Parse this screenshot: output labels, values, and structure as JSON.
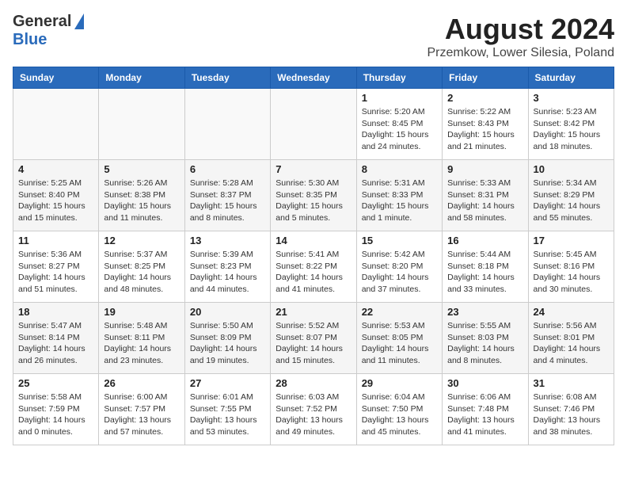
{
  "header": {
    "logo_general": "General",
    "logo_blue": "Blue",
    "month_year": "August 2024",
    "location": "Przemkow, Lower Silesia, Poland"
  },
  "weekdays": [
    "Sunday",
    "Monday",
    "Tuesday",
    "Wednesday",
    "Thursday",
    "Friday",
    "Saturday"
  ],
  "weeks": [
    [
      {
        "day": "",
        "sunrise": "",
        "sunset": "",
        "daylight": ""
      },
      {
        "day": "",
        "sunrise": "",
        "sunset": "",
        "daylight": ""
      },
      {
        "day": "",
        "sunrise": "",
        "sunset": "",
        "daylight": ""
      },
      {
        "day": "",
        "sunrise": "",
        "sunset": "",
        "daylight": ""
      },
      {
        "day": "1",
        "sunrise": "Sunrise: 5:20 AM",
        "sunset": "Sunset: 8:45 PM",
        "daylight": "Daylight: 15 hours and 24 minutes."
      },
      {
        "day": "2",
        "sunrise": "Sunrise: 5:22 AM",
        "sunset": "Sunset: 8:43 PM",
        "daylight": "Daylight: 15 hours and 21 minutes."
      },
      {
        "day": "3",
        "sunrise": "Sunrise: 5:23 AM",
        "sunset": "Sunset: 8:42 PM",
        "daylight": "Daylight: 15 hours and 18 minutes."
      }
    ],
    [
      {
        "day": "4",
        "sunrise": "Sunrise: 5:25 AM",
        "sunset": "Sunset: 8:40 PM",
        "daylight": "Daylight: 15 hours and 15 minutes."
      },
      {
        "day": "5",
        "sunrise": "Sunrise: 5:26 AM",
        "sunset": "Sunset: 8:38 PM",
        "daylight": "Daylight: 15 hours and 11 minutes."
      },
      {
        "day": "6",
        "sunrise": "Sunrise: 5:28 AM",
        "sunset": "Sunset: 8:37 PM",
        "daylight": "Daylight: 15 hours and 8 minutes."
      },
      {
        "day": "7",
        "sunrise": "Sunrise: 5:30 AM",
        "sunset": "Sunset: 8:35 PM",
        "daylight": "Daylight: 15 hours and 5 minutes."
      },
      {
        "day": "8",
        "sunrise": "Sunrise: 5:31 AM",
        "sunset": "Sunset: 8:33 PM",
        "daylight": "Daylight: 15 hours and 1 minute."
      },
      {
        "day": "9",
        "sunrise": "Sunrise: 5:33 AM",
        "sunset": "Sunset: 8:31 PM",
        "daylight": "Daylight: 14 hours and 58 minutes."
      },
      {
        "day": "10",
        "sunrise": "Sunrise: 5:34 AM",
        "sunset": "Sunset: 8:29 PM",
        "daylight": "Daylight: 14 hours and 55 minutes."
      }
    ],
    [
      {
        "day": "11",
        "sunrise": "Sunrise: 5:36 AM",
        "sunset": "Sunset: 8:27 PM",
        "daylight": "Daylight: 14 hours and 51 minutes."
      },
      {
        "day": "12",
        "sunrise": "Sunrise: 5:37 AM",
        "sunset": "Sunset: 8:25 PM",
        "daylight": "Daylight: 14 hours and 48 minutes."
      },
      {
        "day": "13",
        "sunrise": "Sunrise: 5:39 AM",
        "sunset": "Sunset: 8:23 PM",
        "daylight": "Daylight: 14 hours and 44 minutes."
      },
      {
        "day": "14",
        "sunrise": "Sunrise: 5:41 AM",
        "sunset": "Sunset: 8:22 PM",
        "daylight": "Daylight: 14 hours and 41 minutes."
      },
      {
        "day": "15",
        "sunrise": "Sunrise: 5:42 AM",
        "sunset": "Sunset: 8:20 PM",
        "daylight": "Daylight: 14 hours and 37 minutes."
      },
      {
        "day": "16",
        "sunrise": "Sunrise: 5:44 AM",
        "sunset": "Sunset: 8:18 PM",
        "daylight": "Daylight: 14 hours and 33 minutes."
      },
      {
        "day": "17",
        "sunrise": "Sunrise: 5:45 AM",
        "sunset": "Sunset: 8:16 PM",
        "daylight": "Daylight: 14 hours and 30 minutes."
      }
    ],
    [
      {
        "day": "18",
        "sunrise": "Sunrise: 5:47 AM",
        "sunset": "Sunset: 8:14 PM",
        "daylight": "Daylight: 14 hours and 26 minutes."
      },
      {
        "day": "19",
        "sunrise": "Sunrise: 5:48 AM",
        "sunset": "Sunset: 8:11 PM",
        "daylight": "Daylight: 14 hours and 23 minutes."
      },
      {
        "day": "20",
        "sunrise": "Sunrise: 5:50 AM",
        "sunset": "Sunset: 8:09 PM",
        "daylight": "Daylight: 14 hours and 19 minutes."
      },
      {
        "day": "21",
        "sunrise": "Sunrise: 5:52 AM",
        "sunset": "Sunset: 8:07 PM",
        "daylight": "Daylight: 14 hours and 15 minutes."
      },
      {
        "day": "22",
        "sunrise": "Sunrise: 5:53 AM",
        "sunset": "Sunset: 8:05 PM",
        "daylight": "Daylight: 14 hours and 11 minutes."
      },
      {
        "day": "23",
        "sunrise": "Sunrise: 5:55 AM",
        "sunset": "Sunset: 8:03 PM",
        "daylight": "Daylight: 14 hours and 8 minutes."
      },
      {
        "day": "24",
        "sunrise": "Sunrise: 5:56 AM",
        "sunset": "Sunset: 8:01 PM",
        "daylight": "Daylight: 14 hours and 4 minutes."
      }
    ],
    [
      {
        "day": "25",
        "sunrise": "Sunrise: 5:58 AM",
        "sunset": "Sunset: 7:59 PM",
        "daylight": "Daylight: 14 hours and 0 minutes."
      },
      {
        "day": "26",
        "sunrise": "Sunrise: 6:00 AM",
        "sunset": "Sunset: 7:57 PM",
        "daylight": "Daylight: 13 hours and 57 minutes."
      },
      {
        "day": "27",
        "sunrise": "Sunrise: 6:01 AM",
        "sunset": "Sunset: 7:55 PM",
        "daylight": "Daylight: 13 hours and 53 minutes."
      },
      {
        "day": "28",
        "sunrise": "Sunrise: 6:03 AM",
        "sunset": "Sunset: 7:52 PM",
        "daylight": "Daylight: 13 hours and 49 minutes."
      },
      {
        "day": "29",
        "sunrise": "Sunrise: 6:04 AM",
        "sunset": "Sunset: 7:50 PM",
        "daylight": "Daylight: 13 hours and 45 minutes."
      },
      {
        "day": "30",
        "sunrise": "Sunrise: 6:06 AM",
        "sunset": "Sunset: 7:48 PM",
        "daylight": "Daylight: 13 hours and 41 minutes."
      },
      {
        "day": "31",
        "sunrise": "Sunrise: 6:08 AM",
        "sunset": "Sunset: 7:46 PM",
        "daylight": "Daylight: 13 hours and 38 minutes."
      }
    ]
  ]
}
